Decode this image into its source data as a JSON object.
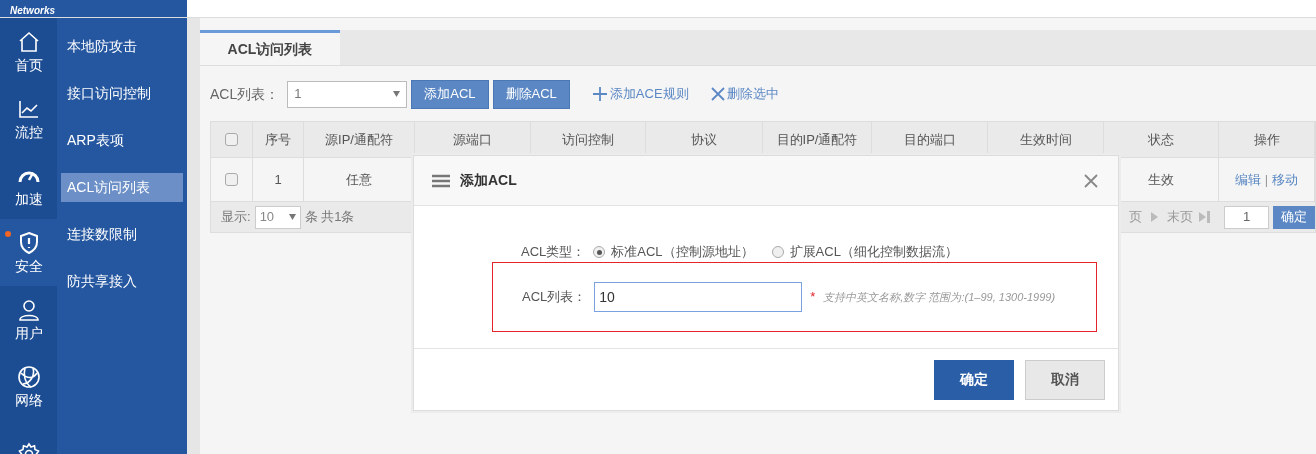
{
  "header": {
    "logo_text": "Networks"
  },
  "nav": [
    {
      "kind": "home",
      "label": "首页",
      "selected": false,
      "alert": false
    },
    {
      "kind": "chart",
      "label": "流控",
      "selected": false,
      "alert": false
    },
    {
      "kind": "gauge",
      "label": "加速",
      "selected": false,
      "alert": false
    },
    {
      "kind": "shield",
      "label": "安全",
      "selected": true,
      "alert": true
    },
    {
      "kind": "user",
      "label": "用户",
      "selected": false,
      "alert": false
    },
    {
      "kind": "globe",
      "label": "网络",
      "selected": false,
      "alert": false
    },
    {
      "kind": "gear",
      "selected": false,
      "alert": false
    }
  ],
  "submenu": [
    {
      "label": "本地防攻击",
      "selected": false
    },
    {
      "label": "接口访问控制",
      "selected": false
    },
    {
      "label": "ARP表项",
      "selected": false
    },
    {
      "label": "ACL访问列表",
      "selected": true
    },
    {
      "label": "连接数限制",
      "selected": false
    },
    {
      "label": "防共享接入",
      "selected": false
    }
  ],
  "tabs": [
    {
      "label": "ACL访问列表",
      "selected": true
    }
  ],
  "toolbar": {
    "label": "ACL列表：",
    "select_value": "1",
    "buttons": [
      "添加ACL",
      "删除ACL"
    ],
    "links": [
      {
        "kind": "add",
        "label": "添加ACE规则"
      },
      {
        "kind": "delete",
        "label": "删除选中"
      }
    ]
  },
  "table": {
    "header_checked": false,
    "columns": [
      "序号",
      "源IP/通配符",
      "源端口",
      "访问控制",
      "协议",
      "目的IP/通配符",
      "目的端口",
      "生效时间",
      "状态",
      "操作"
    ],
    "rows": [
      {
        "checked": false,
        "cells": [
          "1",
          "任意",
          null,
          null,
          null,
          null,
          null,
          null,
          "生效",
          null
        ],
        "actions": [
          "编辑",
          "移动"
        ],
        "action_separator": "|"
      }
    ]
  },
  "pager": {
    "show_label": "显示:",
    "page_size": "10",
    "summary": "条 共1条",
    "prev_fragment": "页",
    "last": "末页",
    "page_input": "1",
    "go": "确定"
  },
  "modal": {
    "title": "添加ACL",
    "type_label": "ACL类型：",
    "types": [
      {
        "label": "标准ACL（控制源地址）",
        "selected": true
      },
      {
        "label": "扩展ACL（细化控制数据流）",
        "selected": false
      }
    ],
    "list_label": "ACL列表：",
    "list_value": "10",
    "highlighted": true,
    "hint_mark": "*",
    "hint": "支持中英文名称,数字 范围为:(1–99, 1300-1999)",
    "buttons": [
      {
        "kind": "primary",
        "label": "确定"
      },
      {
        "kind": "secondary",
        "label": "取消"
      }
    ]
  }
}
